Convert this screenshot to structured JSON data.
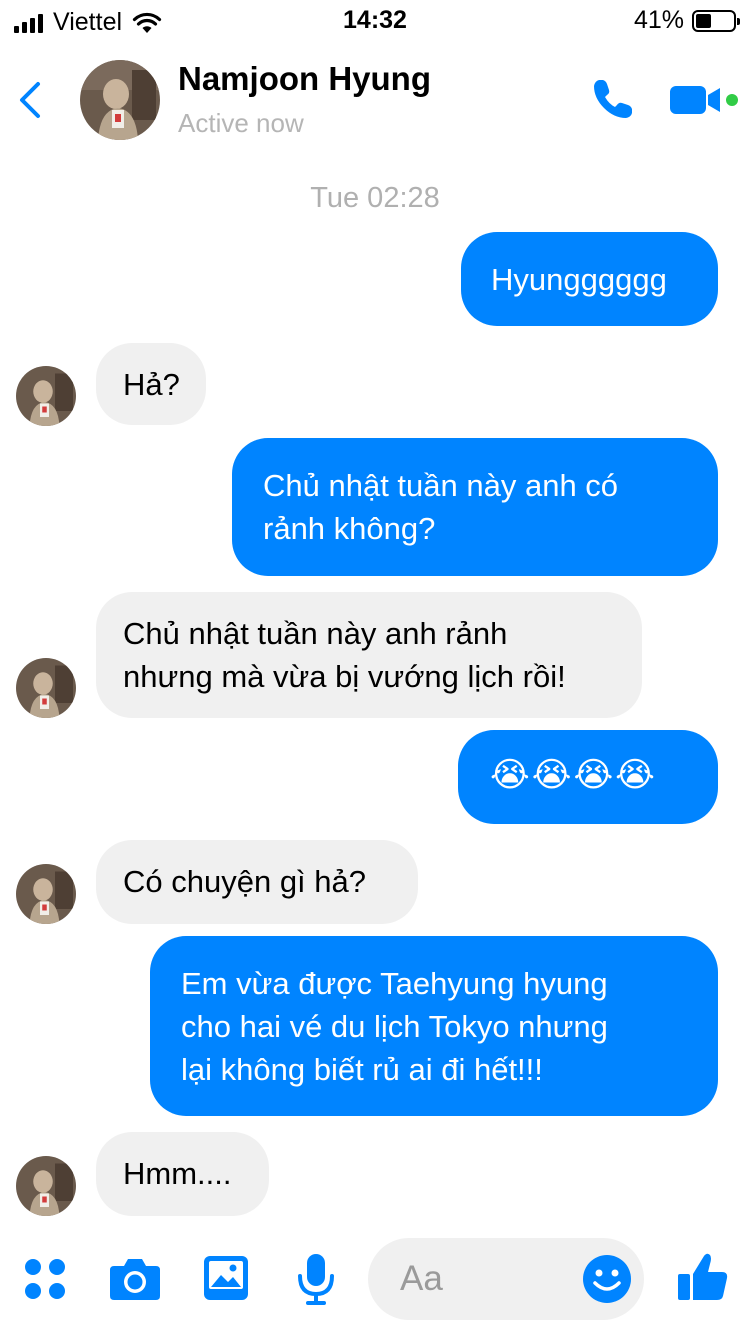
{
  "status_bar": {
    "carrier": "Viettel",
    "time": "14:32",
    "battery": "41%",
    "battery_level": 0.41
  },
  "header": {
    "name": "Namjoon Hyung",
    "status": "Active now"
  },
  "conversation": {
    "timestamp": "Tue 02:28",
    "messages": [
      {
        "from": "me",
        "lines": [
          "Hyungggggg"
        ]
      },
      {
        "from": "them",
        "lines": [
          "Hả?"
        ]
      },
      {
        "from": "me",
        "lines": [
          "Chủ nhật tuần này anh có",
          "rảnh không?"
        ]
      },
      {
        "from": "them",
        "lines": [
          "Chủ nhật tuần này anh rảnh",
          "nhưng mà vừa bị vướng lịch rồi!"
        ]
      },
      {
        "from": "me",
        "lines": [
          "😭😭😭😭"
        ]
      },
      {
        "from": "them",
        "lines": [
          "Có chuyện gì hả?"
        ]
      },
      {
        "from": "me",
        "lines": [
          "Em vừa được Taehyung hyung",
          "cho hai vé du lịch Tokyo nhưng",
          "lại không biết rủ ai đi hết!!!"
        ]
      },
      {
        "from": "them",
        "lines": [
          "Hmm...."
        ]
      }
    ]
  },
  "composer": {
    "placeholder": "Aa"
  },
  "colors": {
    "accent": "#0084ff",
    "incoming_bubble": "#f0f0f0",
    "online_dot": "#31cc46"
  },
  "icons": [
    "back-chevron",
    "phone",
    "video-camera",
    "apps-grid",
    "camera",
    "image",
    "microphone",
    "smiley",
    "thumbs-up"
  ]
}
